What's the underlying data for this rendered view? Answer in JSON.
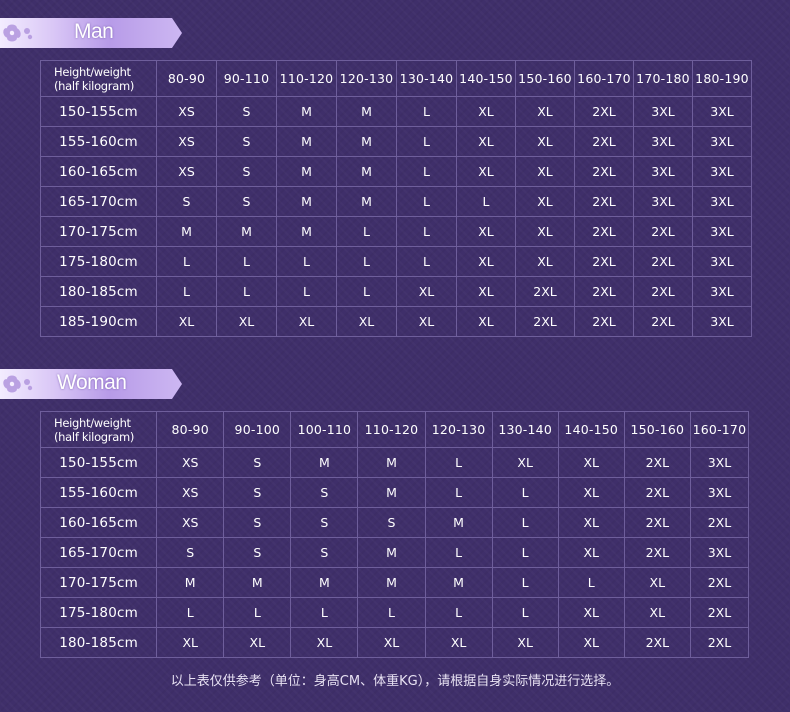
{
  "colors": {
    "background": "#3f2f6a",
    "grid_line": "#6e5e9b",
    "banner_light": "#f3ecff",
    "banner_dark": "#b79be8",
    "text": "#ffffff"
  },
  "man": {
    "title": "Man",
    "corner_line1": "Height/weight",
    "corner_line2": "(half kilogram)",
    "weights": [
      "80-90",
      "90-110",
      "110-120",
      "120-130",
      "130-140",
      "140-150",
      "150-160",
      "160-170",
      "170-180",
      "180-190"
    ],
    "rows": [
      {
        "height": "150-155cm",
        "sizes": [
          "XS",
          "S",
          "M",
          "M",
          "L",
          "XL",
          "XL",
          "2XL",
          "3XL",
          "3XL"
        ]
      },
      {
        "height": "155-160cm",
        "sizes": [
          "XS",
          "S",
          "M",
          "M",
          "L",
          "XL",
          "XL",
          "2XL",
          "3XL",
          "3XL"
        ]
      },
      {
        "height": "160-165cm",
        "sizes": [
          "XS",
          "S",
          "M",
          "M",
          "L",
          "XL",
          "XL",
          "2XL",
          "3XL",
          "3XL"
        ]
      },
      {
        "height": "165-170cm",
        "sizes": [
          "S",
          "S",
          "M",
          "M",
          "L",
          "L",
          "XL",
          "2XL",
          "3XL",
          "3XL"
        ]
      },
      {
        "height": "170-175cm",
        "sizes": [
          "M",
          "M",
          "M",
          "L",
          "L",
          "XL",
          "XL",
          "2XL",
          "2XL",
          "3XL"
        ]
      },
      {
        "height": "175-180cm",
        "sizes": [
          "L",
          "L",
          "L",
          "L",
          "L",
          "XL",
          "XL",
          "2XL",
          "2XL",
          "3XL"
        ]
      },
      {
        "height": "180-185cm",
        "sizes": [
          "L",
          "L",
          "L",
          "L",
          "XL",
          "XL",
          "2XL",
          "2XL",
          "2XL",
          "3XL"
        ]
      },
      {
        "height": "185-190cm",
        "sizes": [
          "XL",
          "XL",
          "XL",
          "XL",
          "XL",
          "XL",
          "2XL",
          "2XL",
          "2XL",
          "3XL"
        ]
      }
    ]
  },
  "woman": {
    "title": "Woman",
    "corner_line1": "Height/weight",
    "corner_line2": "(half kilogram)",
    "weights": [
      "80-90",
      "90-100",
      "100-110",
      "110-120",
      "120-130",
      "130-140",
      "140-150",
      "150-160",
      "160-170"
    ],
    "rows": [
      {
        "height": "150-155cm",
        "sizes": [
          "XS",
          "S",
          "M",
          "M",
          "L",
          "XL",
          "XL",
          "2XL",
          "3XL"
        ]
      },
      {
        "height": "155-160cm",
        "sizes": [
          "XS",
          "S",
          "S",
          "M",
          "L",
          "L",
          "XL",
          "2XL",
          "3XL"
        ]
      },
      {
        "height": "160-165cm",
        "sizes": [
          "XS",
          "S",
          "S",
          "S",
          "M",
          "L",
          "XL",
          "2XL",
          "2XL"
        ]
      },
      {
        "height": "165-170cm",
        "sizes": [
          "S",
          "S",
          "S",
          "M",
          "L",
          "L",
          "XL",
          "2XL",
          "3XL"
        ]
      },
      {
        "height": "170-175cm",
        "sizes": [
          "M",
          "M",
          "M",
          "M",
          "M",
          "L",
          "L",
          "XL",
          "2XL"
        ]
      },
      {
        "height": "175-180cm",
        "sizes": [
          "L",
          "L",
          "L",
          "L",
          "L",
          "L",
          "XL",
          "XL",
          "2XL"
        ]
      },
      {
        "height": "180-185cm",
        "sizes": [
          "XL",
          "XL",
          "XL",
          "XL",
          "XL",
          "XL",
          "XL",
          "2XL",
          "2XL"
        ]
      }
    ]
  },
  "footnote": "以上表仅供参考（单位：身高CM、体重KG），请根据自身实际情况进行选择。"
}
